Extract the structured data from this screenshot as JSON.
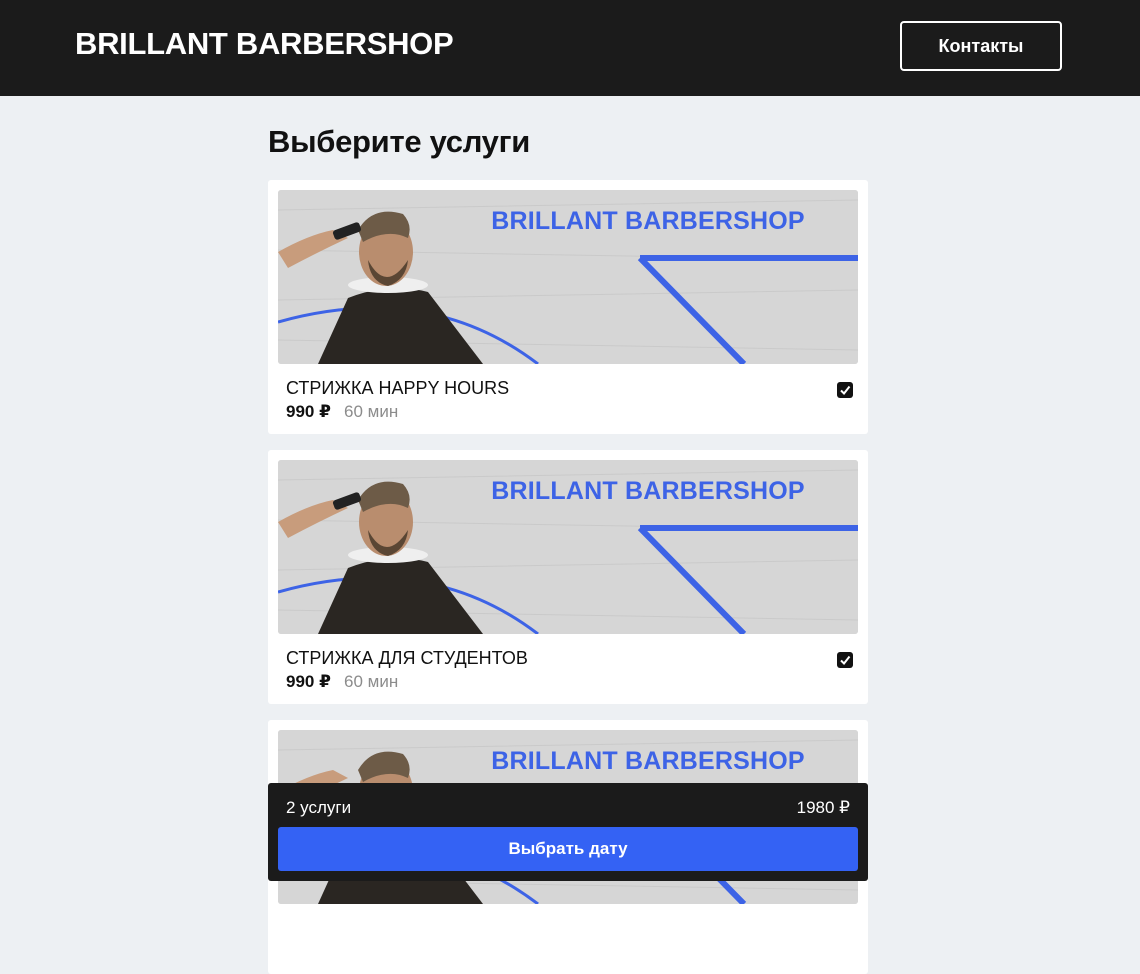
{
  "header": {
    "brand": "BRILLANT BARBERSHOP",
    "contacts_label": "Контакты"
  },
  "main": {
    "title": "Выберите услуги",
    "services": [
      {
        "banner_text": "BRILLANT BARBERSHOP",
        "name": "СТРИЖКА HAPPY HOURS",
        "price": "990 ₽",
        "duration": "60 мин",
        "selected": true
      },
      {
        "banner_text": "BRILLANT BARBERSHOP",
        "name": "СТРИЖКА ДЛЯ СТУДЕНТОВ",
        "price": "990 ₽",
        "duration": "60 мин",
        "selected": true
      },
      {
        "banner_text": "BRILLANT BARBERSHOP",
        "name": "",
        "price": "",
        "duration": "",
        "selected": false
      }
    ]
  },
  "summary": {
    "count_label": "2 услуги",
    "total": "1980 ₽",
    "button_label": "Выбрать дату"
  },
  "colors": {
    "header_bg": "#1b1b1b",
    "accent_blue": "#3462f4",
    "page_bg": "#edf0f3"
  }
}
